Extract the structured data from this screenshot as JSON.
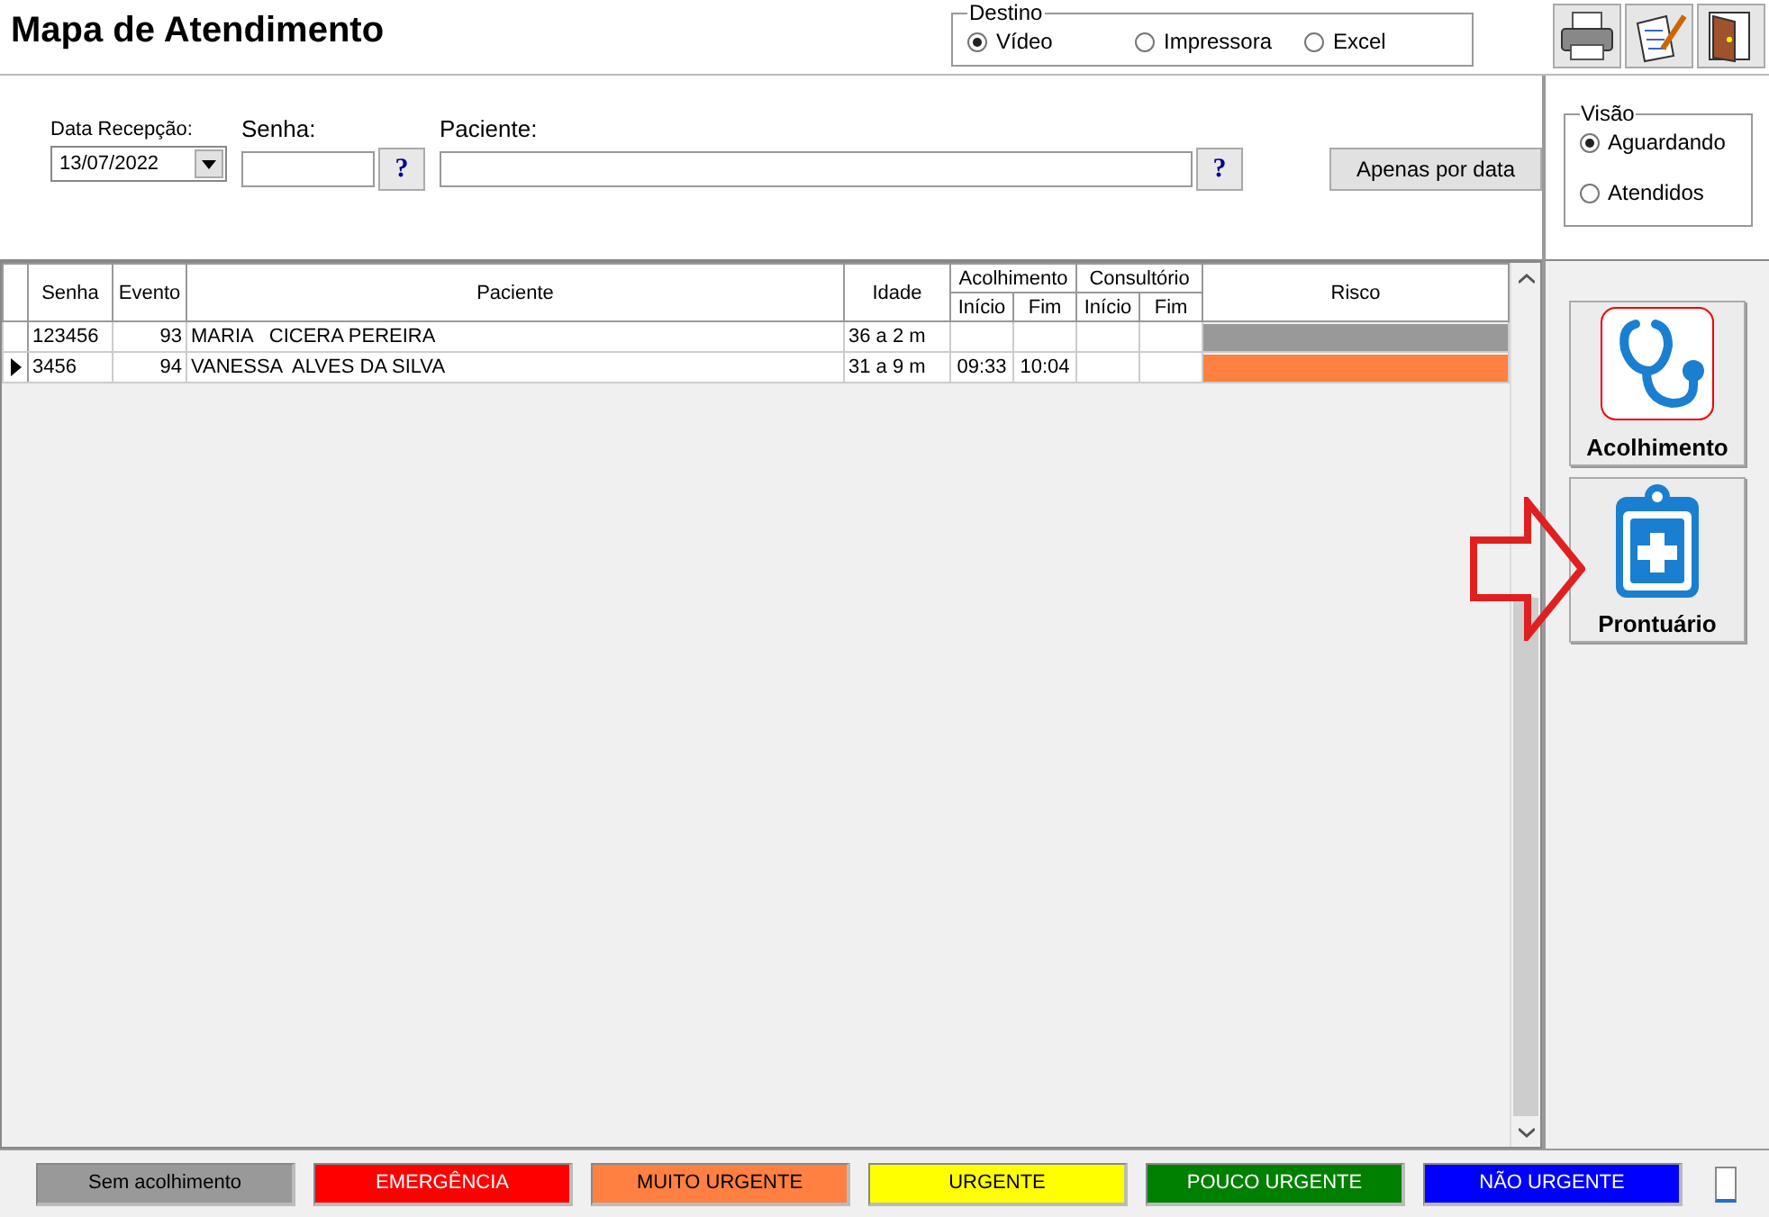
{
  "title": "Mapa de Atendimento",
  "destino": {
    "label": "Destino",
    "options": [
      {
        "label": "Vídeo",
        "selected": true
      },
      {
        "label": "Impressora",
        "selected": false
      },
      {
        "label": "Excel",
        "selected": false
      }
    ]
  },
  "filters": {
    "date": {
      "label": "Data Recepção:",
      "value": "13/07/2022"
    },
    "senha": {
      "label": "Senha:",
      "help": "?"
    },
    "paciente": {
      "label": "Paciente:",
      "help": "?"
    },
    "button": "Apenas por data"
  },
  "visao": {
    "label": "Visão",
    "options": [
      {
        "label": "Aguardando",
        "selected": true
      },
      {
        "label": "Atendidos",
        "selected": false
      }
    ]
  },
  "table": {
    "columns": [
      {
        "label": "Senha"
      },
      {
        "label": "Evento"
      },
      {
        "label": "Paciente"
      },
      {
        "label": "Idade"
      },
      {
        "label": "Acolhimento",
        "children": [
          {
            "label": "Início"
          },
          {
            "label": "Fim"
          }
        ]
      },
      {
        "label": "Consultório",
        "children": [
          {
            "label": "Início"
          },
          {
            "label": "Fim"
          }
        ]
      },
      {
        "label": "Risco"
      }
    ],
    "rows": [
      {
        "selected": false,
        "senha": "123456",
        "evento": "93",
        "paciente": "MARIA   CICERA PEREIRA",
        "idade": "36 a 2 m",
        "color": "#999999"
      },
      {
        "selected": true,
        "senha": "3456",
        "evento": "94",
        "paciente": "VANESSA  ALVES DA SILVA",
        "idade": "31 a 9 m",
        "acolhimento_inicio": "09:33",
        "acolhimento_fim": "10:04",
        "color": "#ff8040"
      }
    ]
  },
  "side_buttons": [
    {
      "label": "Acolhimento",
      "kind": "stethoscope"
    },
    {
      "label": "Prontuário",
      "kind": "clipboard"
    }
  ],
  "legend": [
    {
      "label": "Sem acolhimento",
      "color": "#999999"
    },
    {
      "label": "EMERGÊNCIA",
      "color": "#ff0000"
    },
    {
      "label": "MUITO URGENTE",
      "color": "#ff8040"
    },
    {
      "label": "URGENTE",
      "color": "#ffff00"
    },
    {
      "label": "POUCO URGENTE",
      "color": "#008000"
    },
    {
      "label": "NÃO URGENTE",
      "color": "#0000ff"
    }
  ]
}
